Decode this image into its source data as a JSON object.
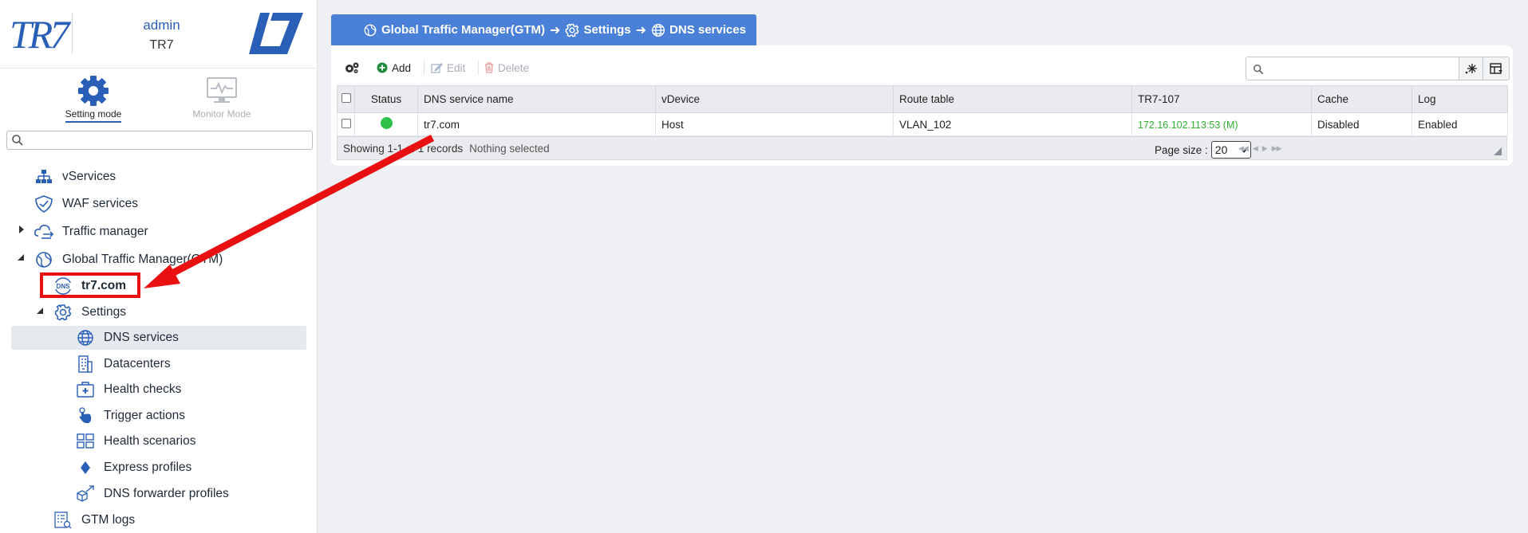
{
  "sidebar": {
    "brand": "TR7",
    "user": {
      "name": "admin",
      "tenant": "TR7"
    },
    "modes": [
      {
        "label": "Setting mode",
        "active": true
      },
      {
        "label": "Monitor Mode",
        "active": false
      }
    ],
    "search": {
      "placeholder": "",
      "value": ""
    },
    "tree": [
      {
        "label": "vServices",
        "icon": "hierarchy-icon"
      },
      {
        "label": "WAF services",
        "icon": "shield-icon"
      },
      {
        "label": "Traffic manager",
        "icon": "cloud-sync-icon"
      },
      {
        "label": "Global Traffic Manager(GTM)",
        "icon": "globe-network-icon"
      },
      {
        "label": "tr7.com",
        "icon": "dns-icon"
      },
      {
        "label": "Settings",
        "icon": "gear-icon"
      },
      {
        "label": "DNS services",
        "icon": "globe-icon"
      },
      {
        "label": "Datacenters",
        "icon": "building-icon"
      },
      {
        "label": "Health checks",
        "icon": "first-aid-icon"
      },
      {
        "label": "Trigger actions",
        "icon": "hand-pointer-icon"
      },
      {
        "label": "Health scenarios",
        "icon": "grid-icon"
      },
      {
        "label": "Express profiles",
        "icon": "diamond-icon"
      },
      {
        "label": "DNS forwarder profiles",
        "icon": "cube-arrow-icon"
      },
      {
        "label": "GTM logs",
        "icon": "log-list-icon"
      }
    ]
  },
  "breadcrumb": {
    "items": [
      "Global Traffic Manager(GTM)",
      "Settings",
      "DNS services"
    ]
  },
  "toolbar": {
    "add_label": "Add",
    "edit_label": "Edit",
    "delete_label": "Delete",
    "search": {
      "placeholder": "",
      "value": ""
    }
  },
  "grid": {
    "columns": [
      "Status",
      "DNS service name",
      "vDevice",
      "Route table",
      "TR7-107",
      "Cache",
      "Log"
    ],
    "rows": [
      {
        "status": "up",
        "name": "tr7.com",
        "vdevice": "Host",
        "route_table": "VLAN_102",
        "tr7_107": "172.16.102.113:53 (M)",
        "cache": "Disabled",
        "log": "Enabled"
      }
    ],
    "footer": {
      "records_text": "Showing 1-1 of 1 records",
      "selection_text": "Nothing selected",
      "page_size_label": "Page size :",
      "page_size": "20"
    }
  },
  "colors": {
    "accent": "#4a80d8",
    "status_up": "#2fc148",
    "annotation": "#e81010"
  }
}
